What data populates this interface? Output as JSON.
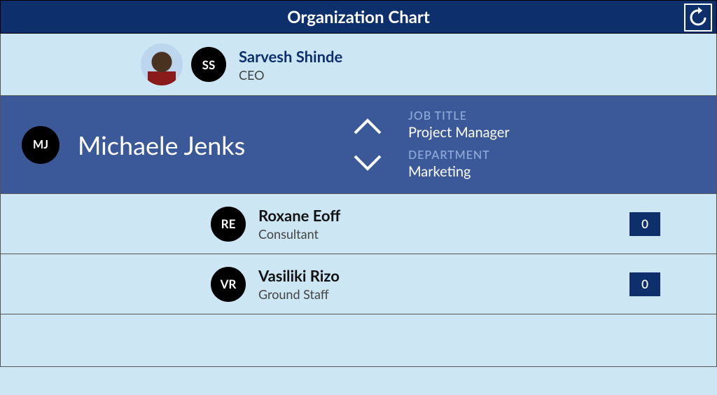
{
  "header": {
    "title": "Organization Chart"
  },
  "parent": {
    "initials": "SS",
    "name": "Sarvesh Shinde",
    "title": "CEO"
  },
  "current": {
    "initials": "MJ",
    "name": "Michaele Jenks",
    "job_title_label": "JOB TITLE",
    "job_title": "Project Manager",
    "department_label": "DEPARTMENT",
    "department": "Marketing"
  },
  "children": [
    {
      "initials": "RE",
      "name": "Roxane Eoff",
      "title": "Consultant",
      "count": "0"
    },
    {
      "initials": "VR",
      "name": "Vasiliki Rizo",
      "title": "Ground Staff",
      "count": "0"
    }
  ]
}
